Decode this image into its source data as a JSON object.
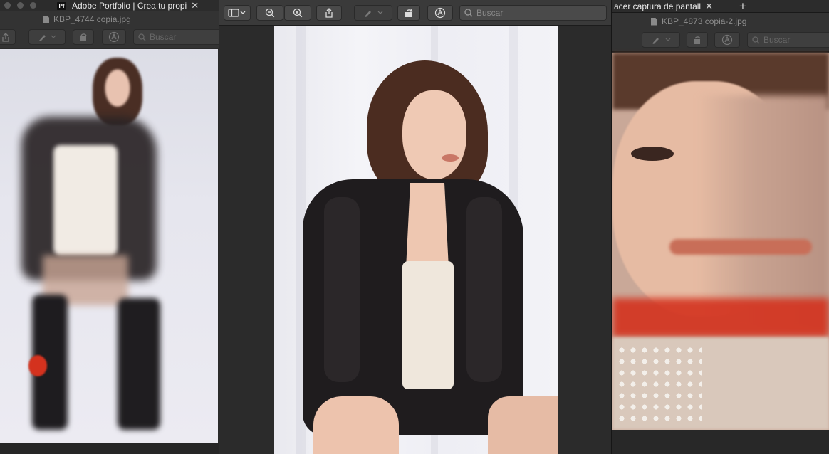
{
  "left_window": {
    "tab_title": "Adobe Portfolio | Crea tu propi",
    "tab_badge": "Pf",
    "file_name": "KBP_4744 copia.jpg",
    "search_placeholder": "Buscar",
    "image_subject": "blurred double-exposure photo of a woman in a leather jacket and black boots"
  },
  "center_window": {
    "search_placeholder": "Buscar",
    "image_subject": "woman with wavy brown hair in black leather jacket and cream slip dress, seated against white curtain"
  },
  "right_window": {
    "tab_title": "acer captura de pantall",
    "file_name": "KBP_4873 copia-2.jpg",
    "search_placeholder": "Buscar",
    "new_tab_label": "+",
    "image_subject": "close-up motion-blurred portrait of a woman with a pearl and cross necklace"
  },
  "colors": {
    "toolbar_bg": "#3a3a3a",
    "button_bg": "#4a4a4a",
    "window_bg": "#2b2b2b",
    "accent_red": "#d4321e"
  },
  "icons": {
    "sidebar_toggle": "sidebar-icon",
    "zoom_out": "zoom-out-icon",
    "zoom_in": "zoom-in-icon",
    "share": "share-icon",
    "markup": "pen-icon",
    "rotate": "rotate-icon",
    "annotate": "markup-circle-icon",
    "search": "search-icon"
  }
}
